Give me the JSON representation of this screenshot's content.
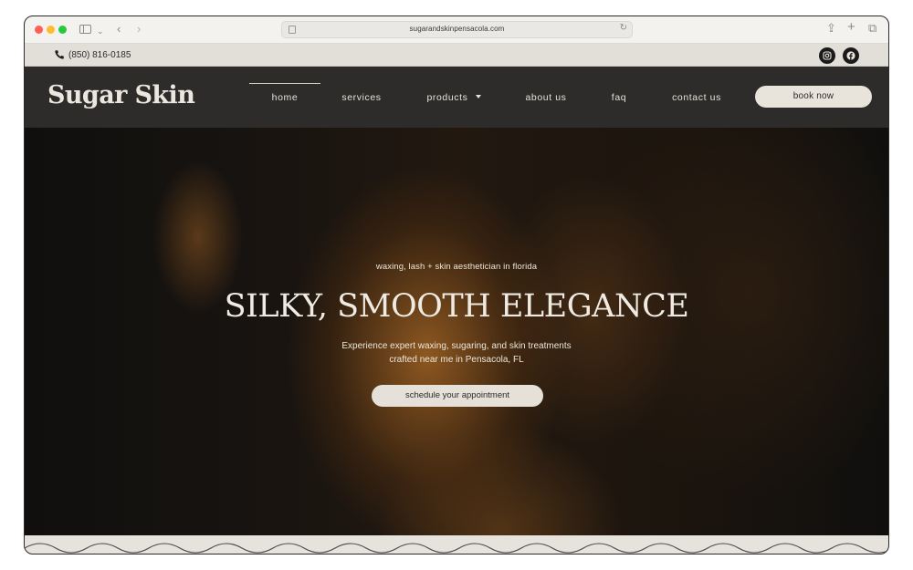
{
  "browser": {
    "url": "sugarandskinpensacola.com"
  },
  "topbar": {
    "phone": "(850) 816-0185",
    "social": [
      "instagram-icon",
      "facebook-icon"
    ]
  },
  "nav": {
    "logo": "Sugar Skin",
    "items": [
      {
        "label": "home",
        "active": true
      },
      {
        "label": "services"
      },
      {
        "label": "products"
      },
      {
        "label": "about us"
      },
      {
        "label": "faq"
      },
      {
        "label": "contact us"
      }
    ],
    "cta": "book now"
  },
  "hero": {
    "eyebrow": "waxing, lash + skin aesthetician in florida",
    "title": "SILKY, SMOOTH ELEGANCE",
    "desc_line1": "Experience expert waxing, sugaring, and skin treatments",
    "desc_line2": "crafted near me in Pensacola, FL",
    "cta": "schedule your appointment"
  },
  "colors": {
    "nav_bg": "#2d2c2a",
    "topbar_bg": "#e2dfd8",
    "button_bg": "#e8e4dc",
    "hero_accent": "#c4792c"
  }
}
